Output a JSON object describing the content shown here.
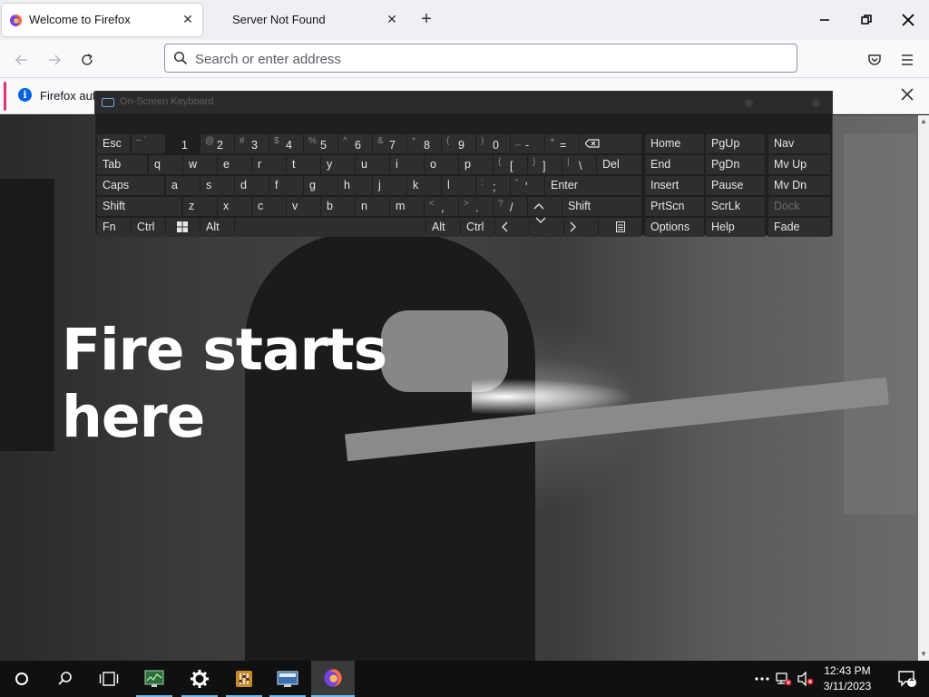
{
  "browser": {
    "tabs": [
      {
        "label": "Welcome to Firefox",
        "active": true
      },
      {
        "label": "Server Not Found",
        "active": false
      }
    ],
    "url_placeholder": "Search or enter address",
    "notification": "Firefox aut"
  },
  "page": {
    "hero_line1": "Fire starts",
    "hero_line2": "here"
  },
  "osk": {
    "title": "On-Screen Keyboard",
    "row1": {
      "esc": "Esc",
      "k1": {
        "sec": "~ `",
        "pri": "1"
      },
      "k2": {
        "sec": "@",
        "pri": "2"
      },
      "k3": {
        "sec": "#",
        "pri": "3"
      },
      "k4": {
        "sec": "$",
        "pri": "4"
      },
      "k5": {
        "sec": "%",
        "pri": "5"
      },
      "k6": {
        "sec": "^",
        "pri": "6"
      },
      "k7": {
        "sec": "&",
        "pri": "7"
      },
      "k8": {
        "sec": "*",
        "pri": "8"
      },
      "k9": {
        "sec": "(",
        "pri": "9"
      },
      "k0": {
        "sec": ")",
        "pri": "0"
      },
      "kminus": {
        "sec": "_",
        "pri": "-"
      },
      "kequal": {
        "sec": "+",
        "pri": "="
      }
    },
    "row2": {
      "tab": "Tab",
      "letters": [
        "q",
        "w",
        "e",
        "r",
        "t",
        "y",
        "u",
        "i",
        "o",
        "p"
      ],
      "lbracket": {
        "sec": "{",
        "pri": "["
      },
      "rbracket": {
        "sec": "}",
        "pri": "]"
      },
      "backslash": {
        "sec": "|",
        "pri": "\\"
      },
      "del": "Del"
    },
    "row3": {
      "caps": "Caps",
      "letters": [
        "a",
        "s",
        "d",
        "f",
        "g",
        "h",
        "j",
        "k",
        "l"
      ],
      "semicolon": {
        "sec": ":",
        "pri": ";"
      },
      "quote": {
        "sec": "\"",
        "pri": "'"
      },
      "enter": "Enter"
    },
    "row4": {
      "shift_left": "Shift",
      "letters": [
        "z",
        "x",
        "c",
        "v",
        "b",
        "n",
        "m"
      ],
      "comma": {
        "sec": "<",
        "pri": ","
      },
      "period": {
        "sec": ">",
        "pri": "."
      },
      "slash": {
        "sec": "?",
        "pri": "/"
      },
      "shift_right": "Shift"
    },
    "row5": {
      "fn": "Fn",
      "ctrl_left": "Ctrl",
      "alt_left": "Alt",
      "alt_right": "Alt",
      "ctrl_right": "Ctrl"
    },
    "nav": [
      [
        "Home",
        "PgUp",
        "Nav"
      ],
      [
        "End",
        "PgDn",
        "Mv Up"
      ],
      [
        "Insert",
        "Pause",
        "Mv Dn"
      ],
      [
        "PrtScn",
        "ScrLk",
        "Dock"
      ],
      [
        "Options",
        "Help",
        "Fade"
      ]
    ]
  },
  "taskbar": {
    "time": "12:43 PM",
    "date": "3/11/2023",
    "notification_count": "1"
  },
  "colors": {
    "accent_blue": "#0060df",
    "taskbar_highlight": "#76b9ed"
  }
}
